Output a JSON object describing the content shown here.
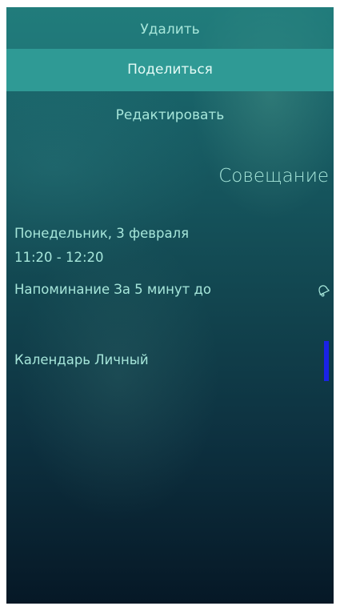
{
  "menu": {
    "delete_label": "Удалить",
    "share_label": "Поделиться",
    "edit_label": "Редактировать"
  },
  "event": {
    "title": "Совещание",
    "date": "Понедельник, 3 февраля",
    "time": "11:20 - 12:20",
    "reminder_label": "Напоминание",
    "reminder_value": "За 5 минут до",
    "calendar_label": "Календарь",
    "calendar_value": "Личный"
  },
  "colors": {
    "text": "#a6e6da",
    "highlight": "#2f9a95",
    "calendar_indicator": "#1a22e6"
  },
  "icons": {
    "reminder": "bell-icon"
  }
}
